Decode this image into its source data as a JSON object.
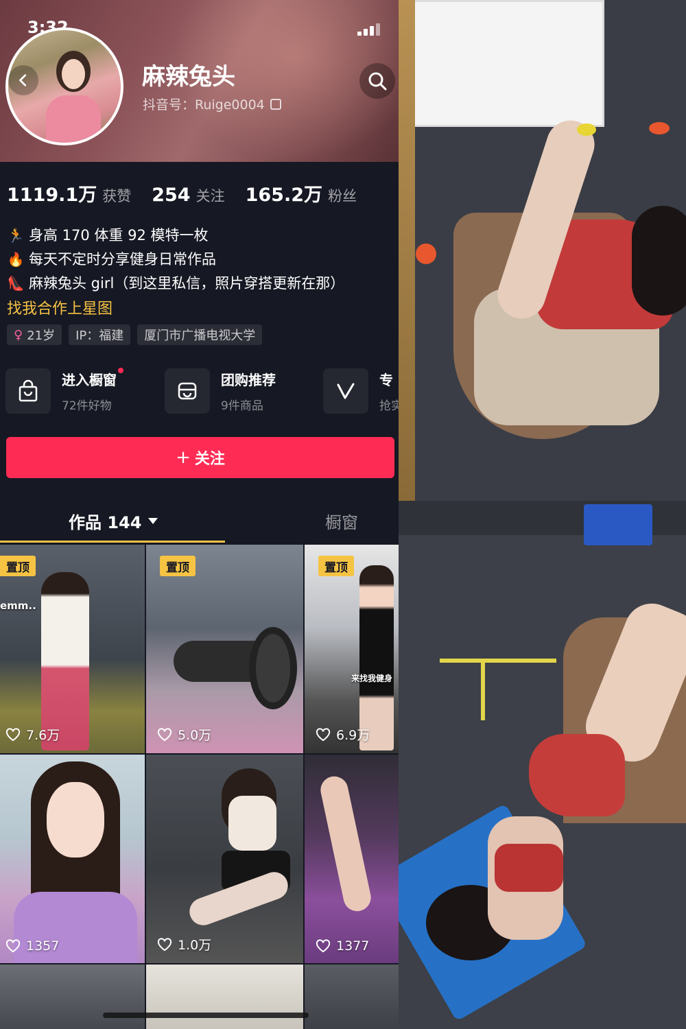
{
  "status": {
    "time": "3:32"
  },
  "profile": {
    "nickname": "麻辣兔头",
    "douyin_id": "抖音号：Ruige0004"
  },
  "stats": [
    {
      "value": "1119.1万",
      "label": "获赞"
    },
    {
      "value": "254",
      "label": "关注"
    },
    {
      "value": "165.2万",
      "label": "粉丝"
    }
  ],
  "bio": {
    "lines": [
      {
        "emoji": "🏃",
        "text": "身高 170 体重 92 模特一枚"
      },
      {
        "emoji": "🔥",
        "text": "每天不定时分享健身日常作品"
      },
      {
        "emoji": "👠",
        "text": "麻辣兔头 girl（到这里私信，照片穿搭更新在那）"
      }
    ],
    "link": "找我合作上星图"
  },
  "tags": {
    "age": "21岁",
    "ip": "IP：福建",
    "school": "厦门市广播电视大学"
  },
  "shop": [
    {
      "title": "进入橱窗",
      "sub": "72件好物",
      "icon": "shopping-bag-icon"
    },
    {
      "title": "团购推荐",
      "sub": "9件商品",
      "icon": "group-buy-icon"
    },
    {
      "title": "专",
      "sub": "抢实",
      "icon": "v-icon"
    }
  ],
  "follow_label": "关注",
  "tabs": {
    "works": "作品 144",
    "window": "橱窗"
  },
  "videos": [
    {
      "pinned": "置顶",
      "likes": "7.6万",
      "overlay": "emm.."
    },
    {
      "pinned": "置顶",
      "likes": "5.0万"
    },
    {
      "pinned": "置顶",
      "likes": "6.9万",
      "overlay": "来找我健身"
    },
    {
      "likes": "1357"
    },
    {
      "likes": "1.0万"
    },
    {
      "likes": "1377"
    }
  ],
  "colors": {
    "accent": "#fe2c55",
    "pin": "#f6c343",
    "background": "#161823"
  }
}
